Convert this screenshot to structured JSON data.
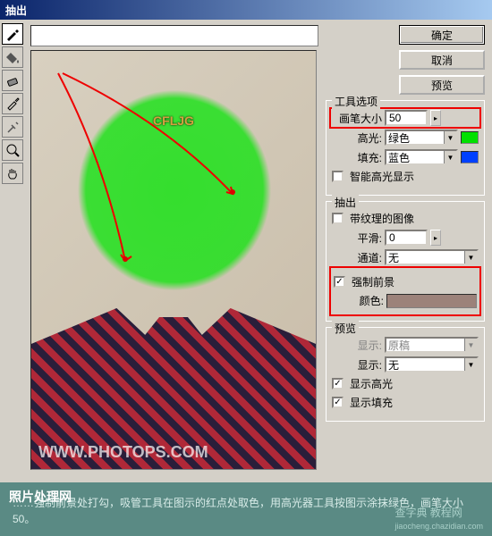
{
  "window": {
    "title": "抽出"
  },
  "buttons": {
    "ok": "确定",
    "cancel": "取消",
    "preview": "预览"
  },
  "tool_options": {
    "legend": "工具选项",
    "brush_size_label": "画笔大小",
    "brush_size_value": "50",
    "highlight_label": "高光:",
    "highlight_value": "绿色",
    "fill_label": "填充:",
    "fill_value": "蓝色",
    "smart_highlight": "智能高光显示"
  },
  "extraction": {
    "legend": "抽出",
    "textured_image": "带纹理的图像",
    "smooth_label": "平滑:",
    "smooth_value": "0",
    "channel_label": "通道:",
    "channel_value": "无",
    "force_fg": "强制前景",
    "color_label": "颜色:",
    "color_hex": "#9c827a"
  },
  "preview_opts": {
    "legend": "预览",
    "show_label_disabled": "显示:",
    "show_value_disabled": "原稿",
    "show_label": "显示:",
    "show_value": "无",
    "show_highlight": "显示高光",
    "show_fill": "显示填充"
  },
  "canvas": {
    "watermark_text": "CFLJG",
    "watermark_site": "WWW.PHOTOPS.COM"
  },
  "footer": {
    "site_brand": "照片处理网",
    "instruction": "……强制前景处打勾，吸管工具在图示的红点处取色，用高光器工具按图示涂抹绿色，画笔大小50。",
    "tag": "查字典  教程网",
    "tag_url": "jiaocheng.chazidian.com"
  }
}
